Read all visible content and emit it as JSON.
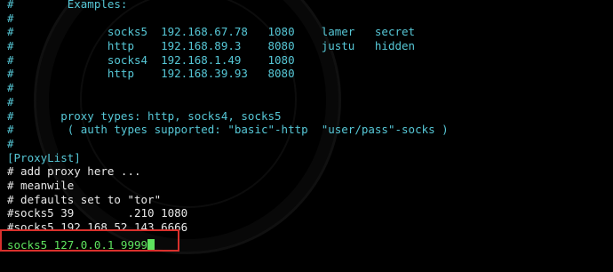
{
  "terminal": {
    "lines": [
      {
        "kind": "comment",
        "text": "#        Examples:"
      },
      {
        "kind": "comment",
        "text": "#"
      },
      {
        "kind": "comment",
        "text": "#              socks5  192.168.67.78   1080    lamer   secret"
      },
      {
        "kind": "comment",
        "text": "#              http    192.168.89.3    8080    justu   hidden"
      },
      {
        "kind": "comment",
        "text": "#              socks4  192.168.1.49    1080"
      },
      {
        "kind": "comment",
        "text": "#              http    192.168.39.93   8080"
      },
      {
        "kind": "comment",
        "text": "#"
      },
      {
        "kind": "comment",
        "text": "#"
      },
      {
        "kind": "comment",
        "text": "#       proxy types: http, socks4, socks5"
      },
      {
        "kind": "comment",
        "text": "#        ( auth types supported: \"basic\"-http  \"user/pass\"-socks )"
      },
      {
        "kind": "comment",
        "text": "#"
      },
      {
        "kind": "section",
        "text": "[ProxyList]"
      },
      {
        "kind": "plain",
        "text": "# add proxy here ..."
      },
      {
        "kind": "plain",
        "text": "# meanwile"
      },
      {
        "kind": "plain",
        "text": "# defaults set to \"tor\""
      },
      {
        "kind": "plain",
        "text": "#socks5 39        .210 1080"
      },
      {
        "kind": "plain",
        "text": "#socks5 192.168.52.143 6666"
      }
    ],
    "active_line": "socks5 127.0.0.1 9999",
    "colors": {
      "comment": "#56c7d6",
      "plain": "#e8e8e8",
      "active": "#5ee35e",
      "highlight_border": "#d9302c",
      "background": "#000000"
    }
  }
}
